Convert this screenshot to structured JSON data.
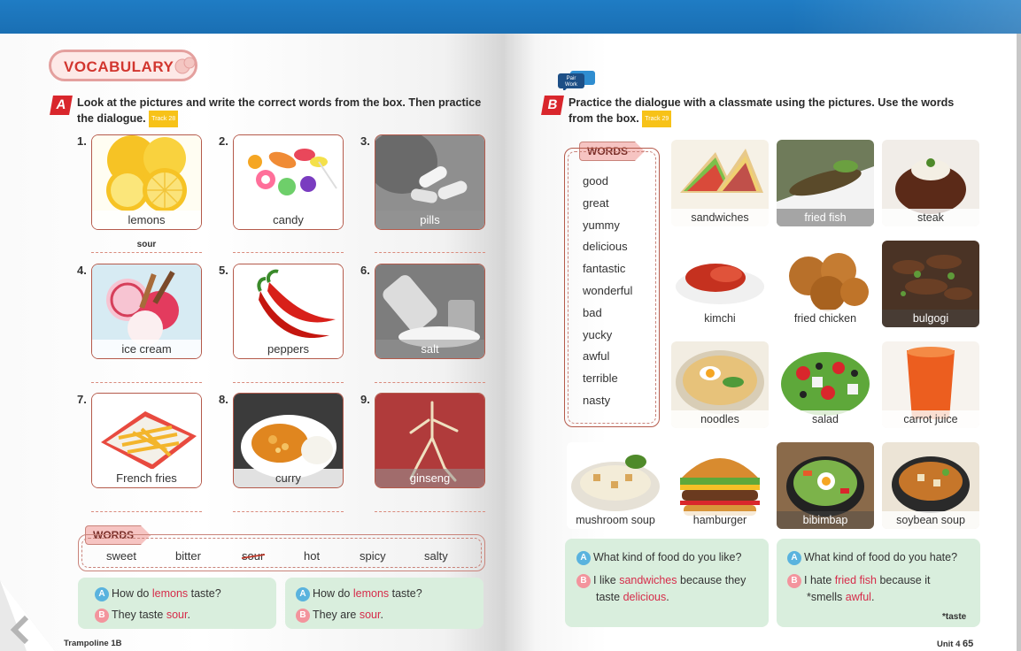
{
  "left": {
    "section_title": "VOCABULARY",
    "a_badge": "A",
    "a_instruction_1": "Look at the pictures and write the correct words from the box. Then practice",
    "a_instruction_2": "the dialogue.",
    "a_track": "Track 28",
    "items": [
      {
        "num": "1.",
        "label": "lemons",
        "answer": "sour"
      },
      {
        "num": "2.",
        "label": "candy",
        "answer": ""
      },
      {
        "num": "3.",
        "label": "pills",
        "answer": ""
      },
      {
        "num": "4.",
        "label": "ice cream",
        "answer": ""
      },
      {
        "num": "5.",
        "label": "peppers",
        "answer": ""
      },
      {
        "num": "6.",
        "label": "salt",
        "answer": ""
      },
      {
        "num": "7.",
        "label": "French fries",
        "answer": ""
      },
      {
        "num": "8.",
        "label": "curry",
        "answer": ""
      },
      {
        "num": "9.",
        "label": "ginseng",
        "answer": ""
      }
    ],
    "words_tag": "WORDS",
    "words": [
      "sweet",
      "bitter",
      "sour",
      "hot",
      "spicy",
      "salty"
    ],
    "dialogues": [
      {
        "a_pre": "How do ",
        "a_key": "lemons",
        "a_post": " taste?",
        "b_pre": "They taste ",
        "b_key": "sour",
        "b_post": "."
      },
      {
        "a_pre": "How do ",
        "a_key": "lemons",
        "a_post": " taste?",
        "b_pre": "They are ",
        "b_key": "sour",
        "b_post": "."
      }
    ],
    "footer": "Trampoline 1B"
  },
  "right": {
    "pair_work": "Pair Work",
    "b_badge": "B",
    "b_instruction_1": "Practice the dialogue with a classmate using the pictures. Use the words",
    "b_instruction_2": "from the box.",
    "b_track": "Track 29",
    "words_tag": "WORDS",
    "words": [
      "good",
      "great",
      "yummy",
      "delicious",
      "fantastic",
      "wonderful",
      "bad",
      "yucky",
      "awful",
      "terrible",
      "nasty"
    ],
    "foods": [
      "sandwiches",
      "fried fish",
      "steak",
      "kimchi",
      "fried chicken",
      "bulgogi",
      "noodles",
      "salad",
      "carrot juice",
      "mushroom soup",
      "hamburger",
      "bibimbap",
      "soybean soup"
    ],
    "dialog1": {
      "a": "What kind of food do you like?",
      "b_pre": "I like ",
      "b_key1": "sandwiches",
      "b_mid": " because they",
      "b_line2_pre": "taste ",
      "b_key2": "delicious",
      "b_post": "."
    },
    "dialog2": {
      "a": "What kind of food do you hate?",
      "b_pre": "I hate ",
      "b_key1": "fried fish",
      "b_mid": " because it",
      "b_line2_pre": "*smells ",
      "b_key2": "awful",
      "b_post": ".",
      "note": "*taste"
    },
    "a_marker": "A",
    "b_marker": "B",
    "footer_unit": "Unit 4",
    "footer_page": "65"
  }
}
